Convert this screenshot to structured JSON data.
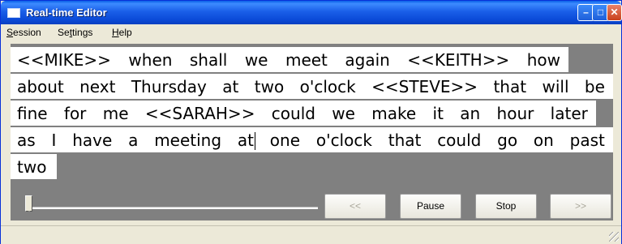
{
  "window": {
    "title": "Real-time Editor"
  },
  "title_buttons": {
    "minimize": "–",
    "maximize": "□",
    "close": "✕"
  },
  "menu": [
    {
      "before": "",
      "accel": "S",
      "after": "ession"
    },
    {
      "before": "Se",
      "accel": "t",
      "after": "tings"
    },
    {
      "before": "",
      "accel": "H",
      "after": "elp"
    }
  ],
  "editor": {
    "lines": [
      [
        "<<MIKE>>",
        "when",
        "shall",
        "we",
        "meet",
        "again",
        "<<KEITH>>",
        "how"
      ],
      [
        "about",
        "next",
        "Thursday",
        "at",
        "two",
        "o'clock",
        "<<STEVE>>",
        "that",
        "will",
        "be"
      ],
      [
        "fine",
        "for",
        "me",
        "<<SARAH>>",
        "could",
        "we",
        "make",
        "it",
        "an",
        "hour",
        "later"
      ],
      [
        "as",
        "I",
        "have",
        "a",
        "meeting",
        "at",
        "one",
        "o'clock",
        "that",
        "could",
        "go",
        "on",
        "past"
      ],
      [
        "two"
      ]
    ]
  },
  "playback": {
    "position_fraction": 0.0,
    "rewind_label": "<<",
    "pause_label": "Pause",
    "stop_label": "Stop",
    "forward_label": ">>"
  },
  "icons": {
    "app": "window-icon",
    "grip": "resize-grip-icon"
  }
}
